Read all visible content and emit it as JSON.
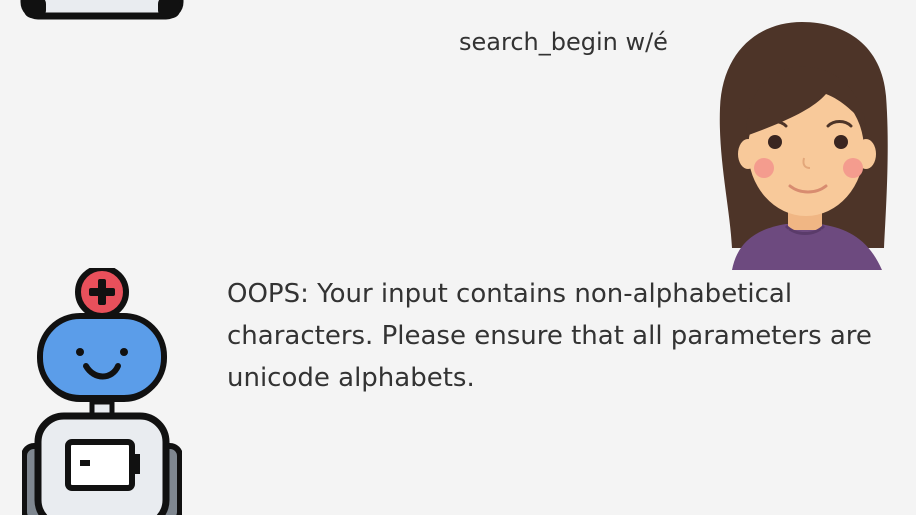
{
  "conversation": {
    "user_message": "search_begin w/é",
    "bot_message": " OOPS: Your input contains non-alphabetical characters. Please ensure that all parameters are unicode alphabets."
  },
  "avatars": {
    "user": {
      "icon": "woman-avatar-icon"
    },
    "bot": {
      "icon": "robot-avatar-icon"
    }
  },
  "colors": {
    "background": "#f4f4f4",
    "text": "#333333",
    "robot_head": "#5b9de9",
    "robot_cross_badge": "#e8505b",
    "robot_body": "#e9ecf0",
    "robot_outline": "#111111",
    "user_hair": "#4d3428",
    "user_skin": "#f8c99a",
    "user_shirt": "#6d4a7f"
  }
}
